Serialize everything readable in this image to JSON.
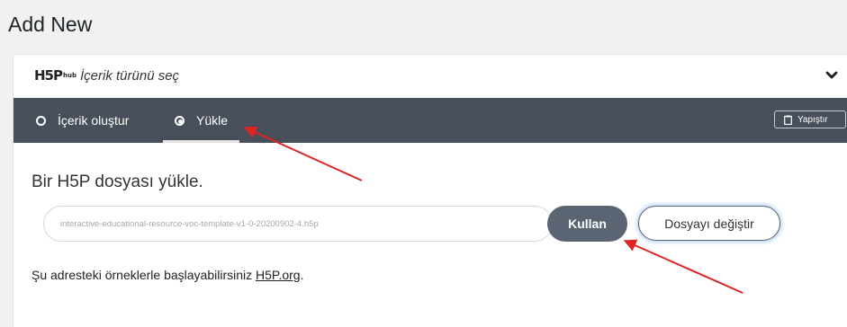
{
  "page": {
    "title": "Add New"
  },
  "hub": {
    "logo_main": "H5P",
    "logo_sub": "hub",
    "title": "İçerik türünü seç"
  },
  "tabs": [
    {
      "label": "İçerik oluştur",
      "selected": false
    },
    {
      "label": "Yükle",
      "selected": true
    }
  ],
  "toolbar": {
    "paste_label": "Yapıştır"
  },
  "upload": {
    "heading": "Bir H5P dosyası yükle.",
    "filename": "interactive-educational-resource-voc-template-v1-0-20200902-4.h5p",
    "use_label": "Kullan",
    "change_label": "Dosyayı değiştir",
    "help_prefix": "Şu adresteki örneklerle başlayabilirsiniz ",
    "help_link": "H5P.org",
    "help_suffix": "."
  },
  "colors": {
    "tabbar_bg": "#474f5a",
    "use_button_bg": "#5a6473",
    "arrow": "#e32222"
  }
}
